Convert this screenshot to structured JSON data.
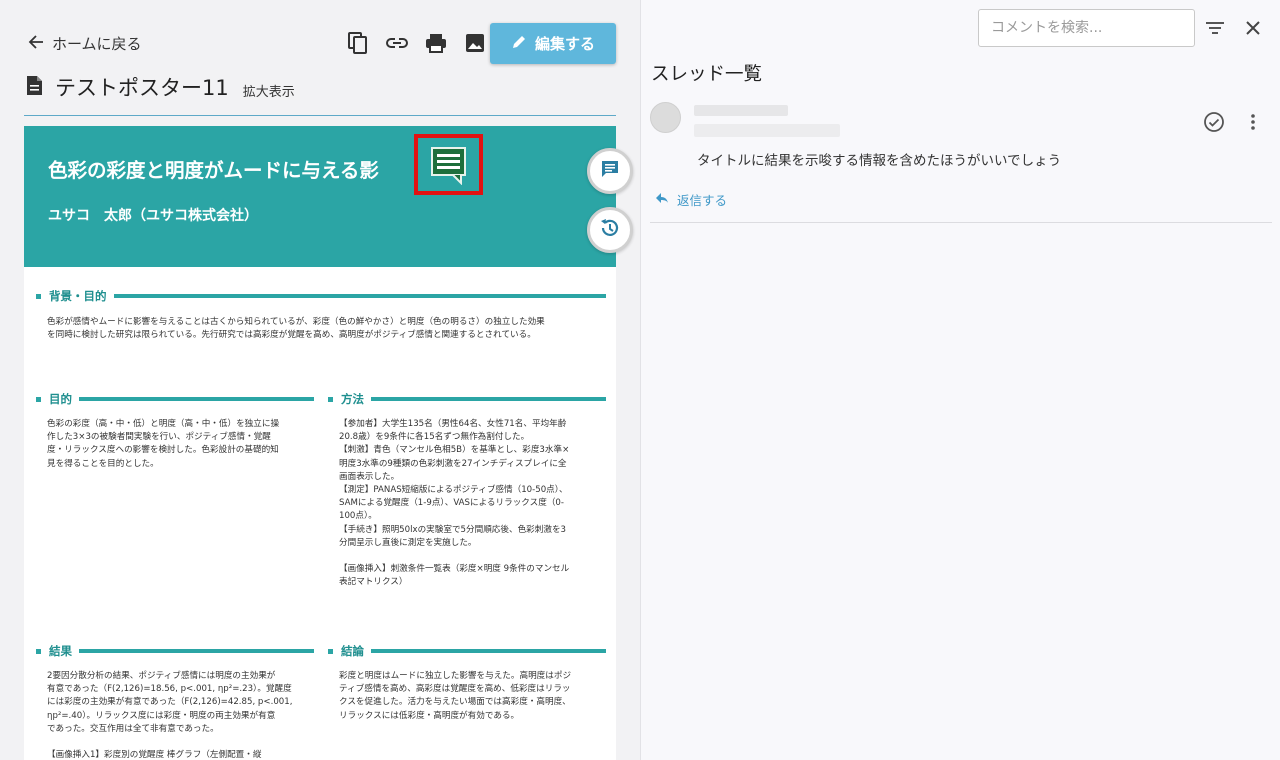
{
  "header": {
    "back_label": "ホームに戻る",
    "edit_label": "編集する",
    "doc_title": "テストポスター11",
    "zoom_label": "拡大表示",
    "toolbar_icons": [
      "copy-icon",
      "link-icon",
      "print-icon",
      "image-icon"
    ]
  },
  "poster": {
    "title": "色彩の彩度と明度がムードに与える影",
    "author": "ユサコ　太郎（ユサコ株式会社）",
    "sections": {
      "background": {
        "heading": "背景・目的",
        "body": "色彩が感情やムードに影響を与えることは古くから知られているが、彩度（色の鮮やかさ）と明度（色の明るさ）の独立した効果\nを同時に検討した研究は限られている。先行研究では高彩度が覚醒を高め、高明度がポジティブ感情と関連するとされている。"
      },
      "purpose": {
        "heading": "目的",
        "body": "色彩の彩度（高・中・低）と明度（高・中・低）を独立に操\n作した3×3の被験者間実験を行い、ポジティブ感情・覚醒\n度・リラックス度への影響を検討した。色彩設計の基礎的知\n見を得ることを目的とした。"
      },
      "method": {
        "heading": "方法",
        "body": "【参加者】大学生135名（男性64名、女性71名、平均年齢\n20.8歳）を9条件に各15名ずつ無作為割付した。\n【刺激】青色（マンセル色相5B）を基準とし、彩度3水準×\n明度3水準の9種類の色彩刺激を27インチディスプレイに全\n画面表示した。\n【測定】PANAS短縮版によるポジティブ感情（10-50点）、\nSAMによる覚醒度（1-9点）、VASによるリラックス度（0-\n100点）。\n【手続き】照明50lxの実験室で5分間順応後、色彩刺激を3\n分間呈示し直後に測定を実施した。\n\n【画像挿入】刺激条件一覧表（彩度×明度 9条件のマンセル\n表記マトリクス）"
      },
      "results": {
        "heading": "結果",
        "body": "2要因分散分析の結果、ポジティブ感情には明度の主効果が\n有意であった（F(2,126)=18.56, p<.001, ηp²=.23）。覚醒度\nには彩度の主効果が有意であった（F(2,126)=42.85, p<.001,\nηp²=.40）。リラックス度には彩度・明度の両主効果が有意\nであった。交互作用は全て非有意であった。\n\n【画像挿入1】彩度別の覚醒度 棒グラフ（左側配置・縦"
      },
      "conclusion": {
        "heading": "結論",
        "body": "彩度と明度はムードに独立した影響を与えた。高明度はポジ\nティブ感情を高め、高彩度は覚醒度を高め、低彩度はリラッ\nクスを促進した。活力を与えたい場面では高彩度・高明度、\nリラックスには低彩度・高明度が有効である。"
      }
    }
  },
  "threads": {
    "search_placeholder": "コメントを検索...",
    "title": "スレッド一覧",
    "items": [
      {
        "text": "タイトルに結果を示唆する情報を含めたほうがいいでしょう",
        "reply_label": "返信する"
      }
    ]
  },
  "colors": {
    "teal": "#2ba5a5",
    "edit_button": "#5fb7dc",
    "highlight_red": "#e11212",
    "reply_blue": "#3f98c8"
  }
}
